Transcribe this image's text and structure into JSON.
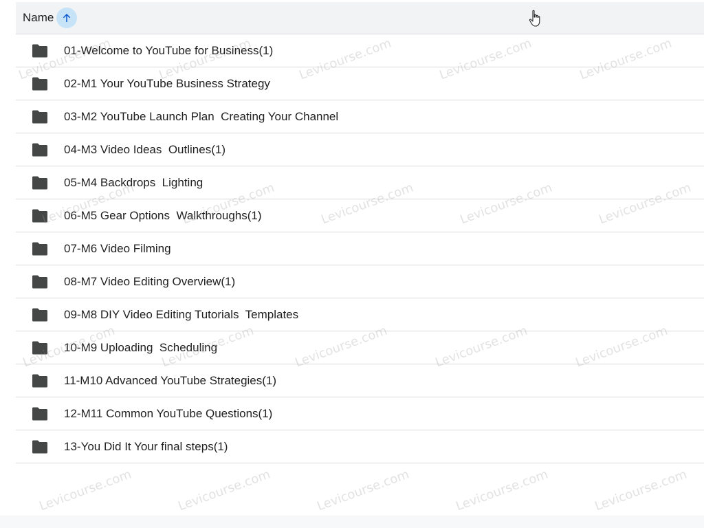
{
  "header": {
    "name_label": "Name",
    "sort_icon": "arrow-up-icon"
  },
  "rows": [
    {
      "name": "01-Welcome to YouTube for Business(1)",
      "icon": "folder-icon"
    },
    {
      "name": "02-M1 Your YouTube Business Strategy",
      "icon": "folder-icon"
    },
    {
      "name": "03-M2 YouTube Launch Plan  Creating Your Channel",
      "icon": "folder-icon"
    },
    {
      "name": "04-M3 Video Ideas  Outlines(1)",
      "icon": "folder-icon"
    },
    {
      "name": "05-M4 Backdrops  Lighting",
      "icon": "folder-icon"
    },
    {
      "name": "06-M5 Gear Options  Walkthroughs(1)",
      "icon": "folder-icon"
    },
    {
      "name": "07-M6 Video Filming",
      "icon": "folder-icon"
    },
    {
      "name": "08-M7 Video Editing Overview(1)",
      "icon": "folder-icon"
    },
    {
      "name": "09-M8 DIY Video Editing Tutorials  Templates",
      "icon": "folder-icon"
    },
    {
      "name": "10-M9 Uploading  Scheduling",
      "icon": "folder-icon"
    },
    {
      "name": "11-M10 Advanced YouTube Strategies(1)",
      "icon": "folder-icon"
    },
    {
      "name": "12-M11 Common YouTube Questions(1)",
      "icon": "folder-icon"
    },
    {
      "name": "13-You Did It Your final steps(1)",
      "icon": "folder-icon"
    }
  ],
  "watermark_text": "Levicourse.com",
  "colors": {
    "header_bg": "#f1f3f4",
    "sort_accent": "#0b57d0",
    "sort_bg": "#c7e3f7",
    "folder": "#444746",
    "divider": "#d7d9dc"
  }
}
